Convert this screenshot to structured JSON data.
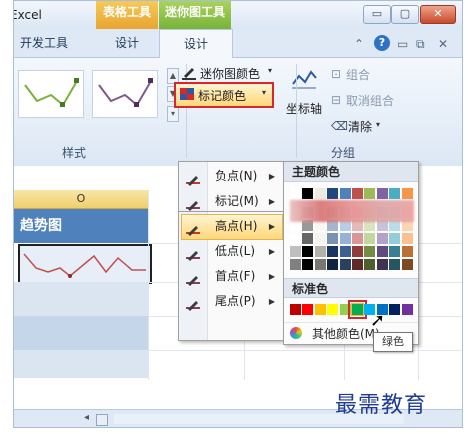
{
  "app_title": "Excel",
  "context_groups": {
    "table_tools": "表格工具",
    "sparkline_tools": "迷你图工具"
  },
  "tabs": [
    {
      "label": "开发工具"
    },
    {
      "label": "设计"
    },
    {
      "label": "设计",
      "active": true
    }
  ],
  "window_buttons": {
    "minimize": "▭",
    "restore": "▢",
    "close": "✕"
  },
  "help_glyph": "?",
  "ribbon": {
    "style_group_label": "样式",
    "sparkline_color_label": "迷你图颜色",
    "marker_color_label": "标记颜色",
    "axis_label": "坐标轴",
    "group_label": "组合",
    "ungroup_label": "取消组合",
    "clear_label": "清除",
    "grouping_label": "分组"
  },
  "sheet": {
    "column_header": "O",
    "title_cell": "趋势图"
  },
  "marker_menu": {
    "items": [
      {
        "label": "负点(N)",
        "color": "#c0392b"
      },
      {
        "label": "标记(M)",
        "color": "#8b3a62"
      },
      {
        "label": "高点(H)",
        "color": "#c0392b",
        "highlighted": true
      },
      {
        "label": "低点(L)",
        "color": "#8b3a62"
      },
      {
        "label": "首点(F)",
        "color": "#8b3a62"
      },
      {
        "label": "尾点(P)",
        "color": "#8b3a62"
      }
    ]
  },
  "color_panel": {
    "theme_title": "主题颜色",
    "standard_title": "标准色",
    "standard_colors": [
      "#c00000",
      "#ff0000",
      "#ffc000",
      "#ffff00",
      "#92d050",
      "#00b050",
      "#00b0f0",
      "#0070c0",
      "#002060",
      "#7030a0"
    ],
    "selected_standard": "#00b050",
    "more_colors_label": "其他颜色(M)..."
  },
  "tooltip": "绿色",
  "watermark": "最需教育"
}
